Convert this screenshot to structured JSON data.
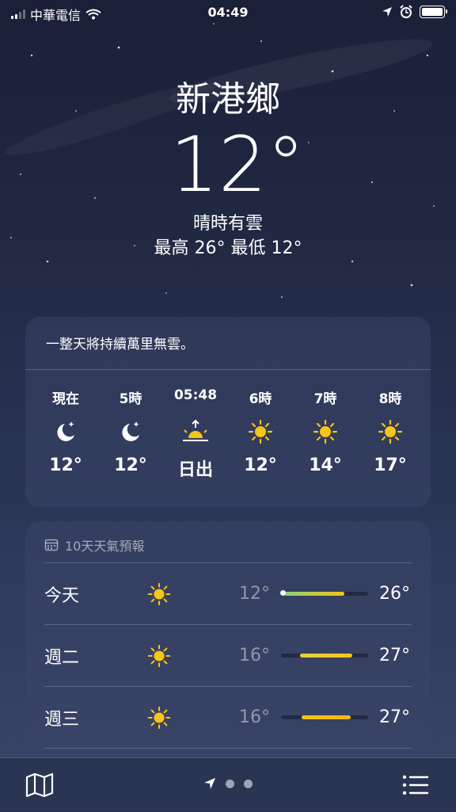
{
  "status": {
    "carrier": "中華電信",
    "time": "04:49"
  },
  "hero": {
    "city": "新港鄉",
    "temperature": "12°",
    "condition": "晴時有雲",
    "hilo": "最高 26°  最低 12°"
  },
  "hourly": {
    "summary": "一整天將持續萬里無雲。",
    "items": [
      {
        "label": "現在",
        "icon": "moon-star-icon",
        "value": "12°"
      },
      {
        "label": "5時",
        "icon": "moon-star-icon",
        "value": "12°"
      },
      {
        "label": "05:48",
        "icon": "sunrise-icon",
        "value": "日出"
      },
      {
        "label": "6時",
        "icon": "sun-icon",
        "value": "12°"
      },
      {
        "label": "7時",
        "icon": "sun-icon",
        "value": "14°"
      },
      {
        "label": "8時",
        "icon": "sun-icon",
        "value": "17°"
      }
    ]
  },
  "daily": {
    "header": "10天天氣預報",
    "days": [
      {
        "name": "今天",
        "icon": "sun-icon",
        "low": "12°",
        "high": "26°"
      },
      {
        "name": "週二",
        "icon": "sun-icon",
        "low": "16°",
        "high": "27°"
      },
      {
        "name": "週三",
        "icon": "sun-icon",
        "low": "16°",
        "high": "27°"
      }
    ]
  },
  "colors": {
    "sun": "#f5c518",
    "bar_start": "#8bd17c",
    "bar_end": "#f5c518"
  }
}
